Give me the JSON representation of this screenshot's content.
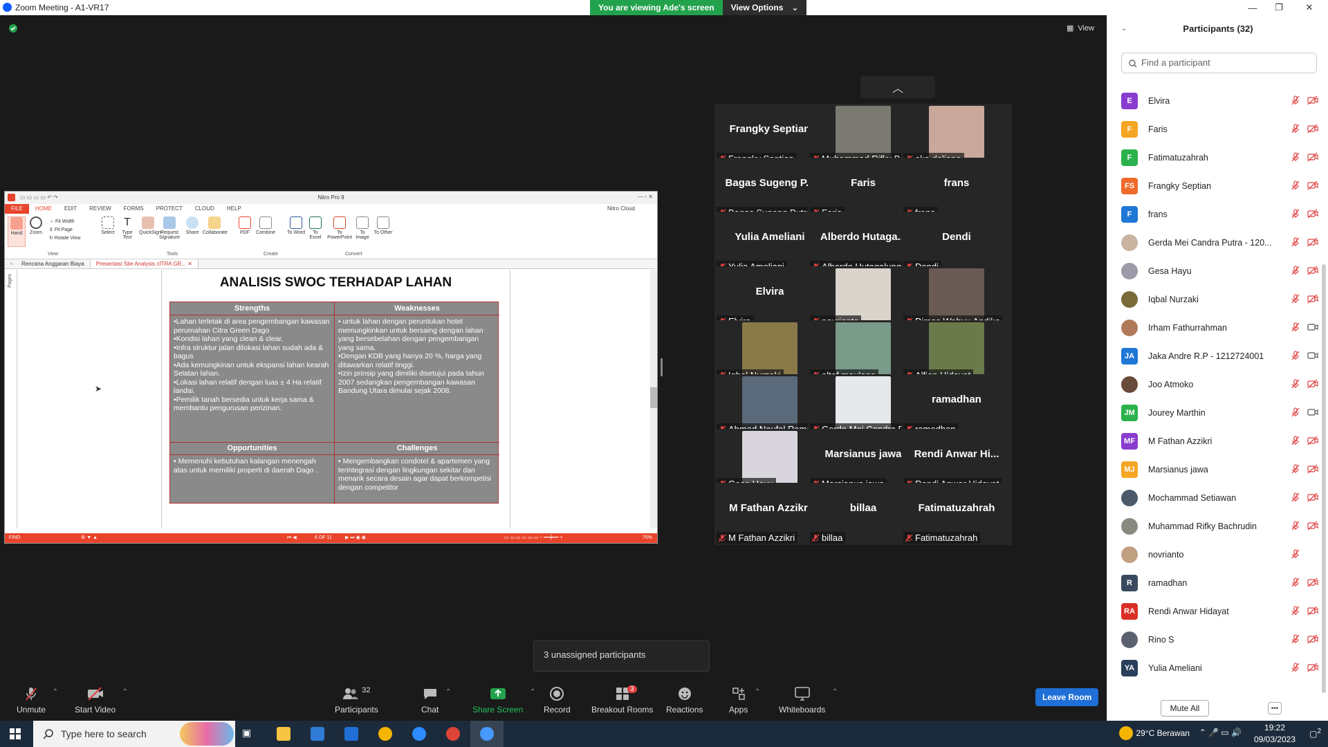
{
  "window": {
    "title": "Zoom Meeting - A1-VR17"
  },
  "banner": {
    "viewing": "You are viewing Ade's screen",
    "view_options": "View Options"
  },
  "top_right": {
    "view_label": "View"
  },
  "nitro": {
    "title": "Nitro Pro 9",
    "cloud": "Nitro Cloud",
    "tabs": [
      "FILE",
      "HOME",
      "EDIT",
      "REVIEW",
      "FORMS",
      "PROTECT",
      "CLOUD",
      "HELP"
    ],
    "ribbon": {
      "hand": "Hand",
      "zoom": "Zoom",
      "fit_width": "Fit Width",
      "fit_page": "Fit Page",
      "rotate": "Rotate View",
      "select": "Select",
      "type_text": "Type Text",
      "quicksign": "QuickSign",
      "request_sig": "Request Signature",
      "share": "Share",
      "collaborate": "Collaborate",
      "pdf": "PDF",
      "combine": "Combine",
      "to_word": "To Word",
      "to_excel": "To Excel",
      "to_ppt": "To PowerPoint",
      "to_image": "To Image",
      "to_other": "To Other",
      "group_view": "View",
      "group_tools": "Tools",
      "group_create": "Create",
      "group_convert": "Convert"
    },
    "doc_tabs": [
      "Rencana Anggaran Biaya",
      "Presentasi Site Analysis cITRA GR..."
    ],
    "pages_label": "Pages",
    "page_title": "ANALISIS SWOC TERHADAP LAHAN",
    "swoc": {
      "strengths_h": "Strengths",
      "weaknesses_h": "Weaknesses",
      "opportunities_h": "Opportunities",
      "challenges_h": "Challenges",
      "strengths": "•Lahan terletak di area pengembangan kawasan perumahan Citra Green Dago\n•Kondisi lahan yang clean & clear.\n•Infra struktur jalan dilokasi lahan sudah ada & bagus\n•Ada kemungkinan untuk ekspansi lahan kearah Selatan lahan.\n•Lokasi lahan relatif dengan luas ± 4 Ha relatif landai.\n•Pemilik tanah bersedia untuk kerja sama & membantu pengurusan perizinan.",
      "weaknesses": "• untuk lahan dengan peruntukan hotel memungkinkan untuk bersaing dengan lahan yang bersebelahan dengan pengembangan yang sama.\n•Dengan KDB yang hanya 20 %, harga yang ditawarkan relatif tinggi.\n•Izin prinsip yang dimiliki disetujui pada tahun 2007 sedangkan pengembangan kawasan Bandung Utara dimulai sejak 2008.",
      "opportunities": "• Memenuhi kebutuhan kalangan menengah atas untuk memiliki properti di daerah Dago .",
      "challenges": "• Mengembangkan condotel  & apartemen yang terintegrasi dengan lingkungan sekitar dan menarik secara desain agar dapat berkompetisi dengan competitor"
    },
    "status": {
      "find": "FIND",
      "page": "6 OF 11",
      "zoom": "75%"
    }
  },
  "gallery": [
    {
      "big": "Frangky Septian",
      "label": "Frangky Septian",
      "photo": false
    },
    {
      "big": "",
      "label": "Muhammad Rifky Bac...",
      "photo": true,
      "color": "#7a7a72"
    },
    {
      "big": "",
      "label": "eka deliana",
      "photo": true,
      "color": "#c9a79a"
    },
    {
      "big": "Bagas Sugeng P...",
      "label": "Bagas Sugeng Putrat...",
      "photo": false
    },
    {
      "big": "Faris",
      "label": "Faris",
      "photo": false
    },
    {
      "big": "frans",
      "label": "frans",
      "photo": false
    },
    {
      "big": "Yulia Ameliani",
      "label": "Yulia Ameliani",
      "photo": false
    },
    {
      "big": "Alberdo  Hutaga...",
      "label": "Alberdo Hutagalung",
      "photo": false
    },
    {
      "big": "Dendi",
      "label": "Dendi",
      "photo": false
    },
    {
      "big": "Elvira",
      "label": "Elvira",
      "photo": false
    },
    {
      "big": "",
      "label": "novrianto",
      "photo": true,
      "color": "#d9d4cc"
    },
    {
      "big": "",
      "label": "Dimas Wahyu Andika",
      "photo": true,
      "color": "#6a5a54"
    },
    {
      "big": "",
      "label": "Iqbal Nurzaki",
      "photo": true,
      "color": "#8a7a4a"
    },
    {
      "big": "",
      "label": "altaf maulana",
      "photo": true,
      "color": "#7a9a8a"
    },
    {
      "big": "",
      "label": "Alfian Hidayat",
      "photo": true,
      "color": "#6b7a4a"
    },
    {
      "big": "",
      "label": "Ahmad Naufal Rama...",
      "photo": true,
      "color": "#5a6a7a"
    },
    {
      "big": "",
      "label": "Gerda Mei Candra Pu...",
      "photo": true,
      "color": "#e6e8ec"
    },
    {
      "big": "ramadhan",
      "label": "ramadhan",
      "photo": false
    },
    {
      "big": "",
      "label": "Gesa Hayu",
      "photo": true,
      "color": "#d8d6dc"
    },
    {
      "big": "Marsianus jawa",
      "label": "Marsianus jawa",
      "photo": false
    },
    {
      "big": "Rendi Anwar Hi...",
      "label": "Rendi Anwar Hidayat",
      "photo": false
    },
    {
      "big": "M Fathan Azzikri",
      "label": "M Fathan Azzikri",
      "photo": false
    },
    {
      "big": "billaa",
      "label": "billaa",
      "photo": false
    },
    {
      "big": "Fatimatuzahrah",
      "label": "Fatimatuzahrah",
      "photo": false
    }
  ],
  "unassigned": "3 unassigned participants",
  "toolbar": {
    "unmute": "Unmute",
    "start_video": "Start Video",
    "participants": "Participants",
    "participants_count": "32",
    "chat": "Chat",
    "share_screen": "Share Screen",
    "record": "Record",
    "breakout": "Breakout Rooms",
    "breakout_badge": "3",
    "reactions": "Reactions",
    "apps": "Apps",
    "whiteboards": "Whiteboards",
    "leave": "Leave Room"
  },
  "panel": {
    "title": "Participants (32)",
    "search_placeholder": "Find a participant",
    "mute_all": "Mute All",
    "participants": [
      {
        "initials": "E",
        "name": "Elvira",
        "color": "#8a3ccf",
        "video": false
      },
      {
        "initials": "F",
        "name": "Faris",
        "color": "#f5a623",
        "video": false
      },
      {
        "initials": "F",
        "name": "Fatimatuzahrah",
        "color": "#2bb24c",
        "video": false
      },
      {
        "initials": "FS",
        "name": "Frangky Septian",
        "color": "#f06a2a",
        "video": false
      },
      {
        "initials": "F",
        "name": "frans",
        "color": "#1f77d6",
        "video": false
      },
      {
        "initials": "",
        "name": "Gerda Mei Candra Putra - 120...",
        "color": "#c8b4a0",
        "video": false
      },
      {
        "initials": "",
        "name": "Gesa Hayu",
        "color": "#9a9aa8",
        "video": false
      },
      {
        "initials": "",
        "name": "Iqbal Nurzaki",
        "color": "#7a6a3a",
        "video": false
      },
      {
        "initials": "",
        "name": "Irham Fathurrahman",
        "color": "#b07a5a",
        "video": true
      },
      {
        "initials": "JA",
        "name": "Jaka Andre R.P - 1212724001",
        "color": "#1f77d6",
        "video": true
      },
      {
        "initials": "",
        "name": "Joo Atmoko",
        "color": "#6a4a3a",
        "video": false
      },
      {
        "initials": "JM",
        "name": "Jourey Marthin",
        "color": "#2bb24c",
        "video": true
      },
      {
        "initials": "MF",
        "name": "M Fathan Azzikri",
        "color": "#8a3ccf",
        "video": false
      },
      {
        "initials": "MJ",
        "name": "Marsianus jawa",
        "color": "#f5a623",
        "video": false
      },
      {
        "initials": "",
        "name": "Mochammad Setiawan",
        "color": "#4a5a6a",
        "video": false
      },
      {
        "initials": "",
        "name": "Muhammad Rifky Bachrudin",
        "color": "#8a8a80",
        "video": false
      },
      {
        "initials": "",
        "name": "novrianto",
        "color": "#c0a080",
        "video": null
      },
      {
        "initials": "R",
        "name": "ramadhan",
        "color": "#3a4a5e",
        "video": false
      },
      {
        "initials": "RA",
        "name": "Rendi Anwar Hidayat",
        "color": "#d93025",
        "video": false
      },
      {
        "initials": "",
        "name": "Rino S",
        "color": "#5a6070",
        "video": false
      },
      {
        "initials": "YA",
        "name": "Yulia Ameliani",
        "color": "#2a3f5a",
        "video": false
      }
    ]
  },
  "taskbar": {
    "search_placeholder": "Type here to search",
    "weather": "29°C  Berawan",
    "time": "19:22",
    "date": "09/03/2023",
    "notif": "2"
  },
  "colors": {
    "accent_red": "#e8442b",
    "zoom_blue": "#1f6fd6",
    "share_green": "#23a24d",
    "mute_red": "#e04040"
  }
}
